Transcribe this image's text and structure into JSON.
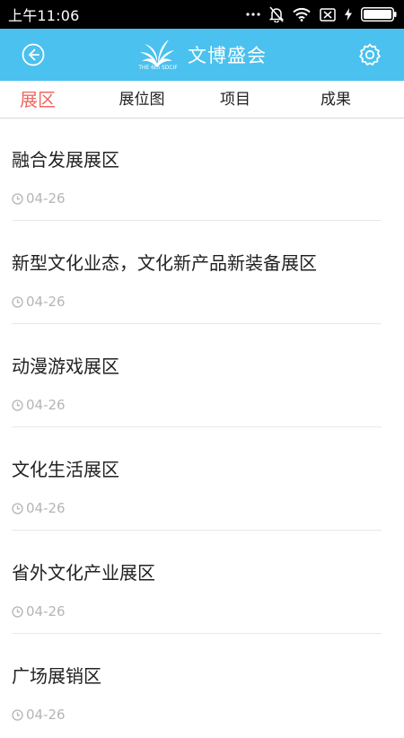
{
  "status_bar": {
    "time": "上午11:06",
    "icons": [
      "more-dots-icon",
      "notification-off-icon",
      "wifi-icon",
      "sim-off-icon",
      "charging-icon",
      "battery-icon"
    ]
  },
  "header": {
    "title": "文博盛会",
    "logo_text": "THE 6th SDCIF",
    "background_color": "#4ac1ee"
  },
  "tabs": [
    {
      "label": "展区",
      "active": true
    },
    {
      "label": "展位图",
      "active": false
    },
    {
      "label": "项目",
      "active": false
    },
    {
      "label": "成果",
      "active": false
    }
  ],
  "colors": {
    "active_tab": "#ee6a62",
    "date_text": "#b5b5b5"
  },
  "items": [
    {
      "title": "融合发展展区",
      "date": "04-26"
    },
    {
      "title": "新型文化业态，文化新产品新装备展区",
      "date": "04-26"
    },
    {
      "title": "动漫游戏展区",
      "date": "04-26"
    },
    {
      "title": "文化生活展区",
      "date": "04-26"
    },
    {
      "title": "省外文化产业展区",
      "date": "04-26"
    },
    {
      "title": "广场展销区",
      "date": "04-26"
    }
  ]
}
